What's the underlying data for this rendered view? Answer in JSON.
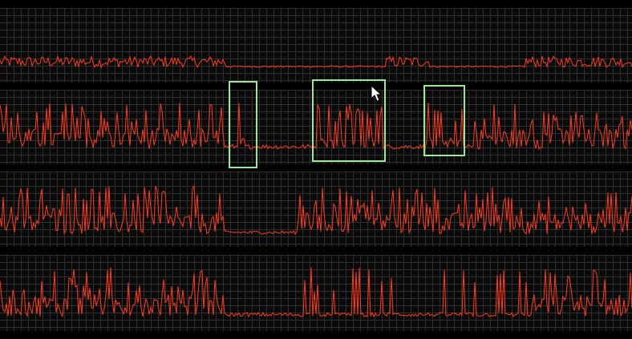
{
  "colors": {
    "background": "#000000",
    "grid": "#2f2f2f",
    "trace": "#ff3b1f",
    "selection": "#9be89b"
  },
  "channels": [
    {
      "id": "ch1"
    },
    {
      "id": "ch2"
    },
    {
      "id": "ch3"
    },
    {
      "id": "ch4"
    }
  ],
  "selections": [
    {
      "id": "sel1",
      "channel": "ch2"
    },
    {
      "id": "sel2",
      "channel": "ch2"
    },
    {
      "id": "sel3",
      "channel": "ch2"
    }
  ],
  "cursor_icon": "arrow-pointer-icon"
}
